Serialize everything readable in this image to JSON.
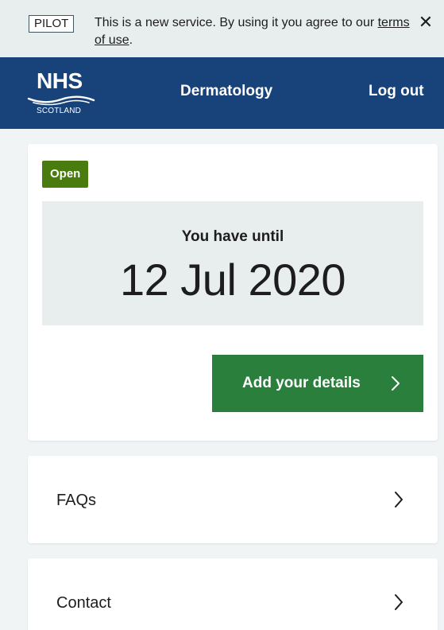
{
  "pilot_banner": {
    "tag": "PILOT",
    "text": "This is a new service. By using it you agree to our ",
    "link_text": "terms of use",
    "text_end": ".",
    "close_icon": "close-icon"
  },
  "header": {
    "logo_title": "NHS",
    "logo_subtitle": "SCOTLAND",
    "nav": {
      "service": "Dermatology",
      "logout": "Log out"
    },
    "brand_color": "#18437a"
  },
  "status_card": {
    "status": "Open",
    "status_color": "#4a7b0f",
    "deadline_label": "You have until",
    "deadline_date": "12 Jul 2020",
    "action_button": "Add your details",
    "action_color": "#2a7f3c"
  },
  "links": [
    {
      "label": "FAQs"
    },
    {
      "label": "Contact"
    }
  ]
}
